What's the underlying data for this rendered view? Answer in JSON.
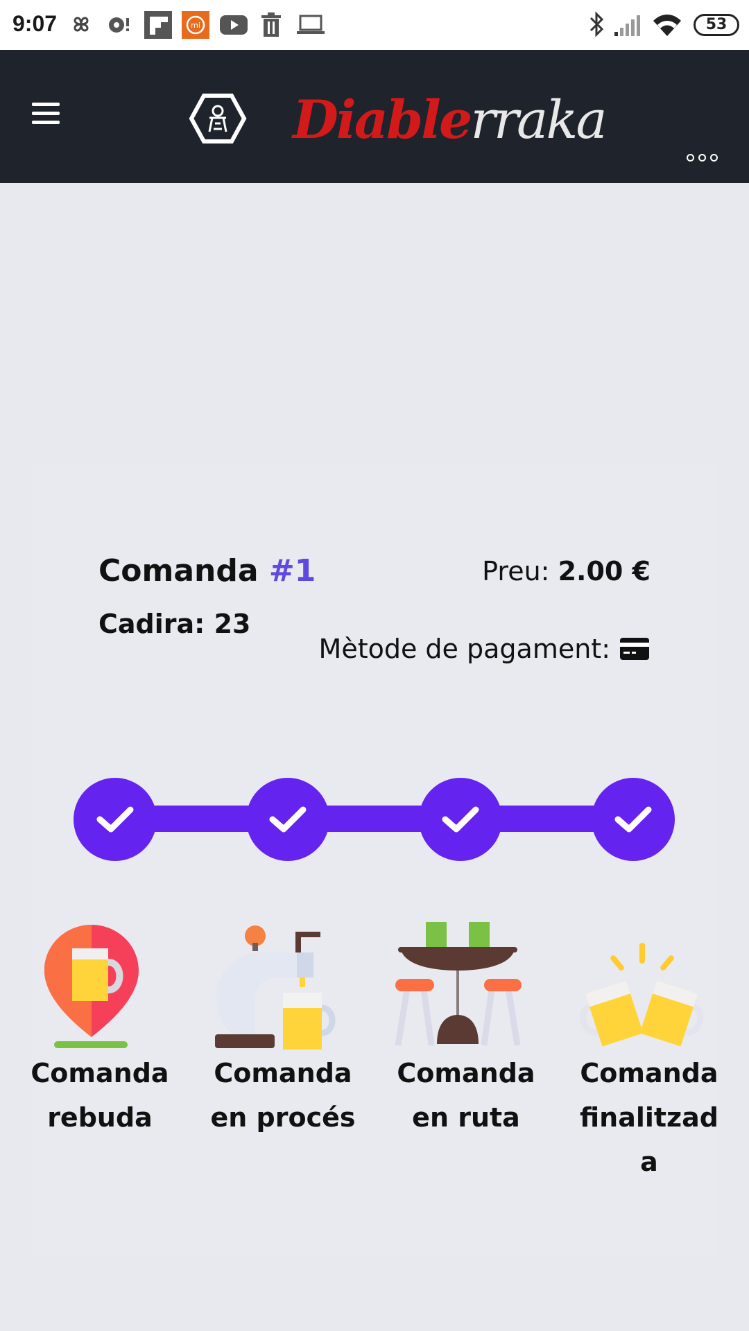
{
  "status_bar": {
    "time": "9:07",
    "battery": "53"
  },
  "header": {
    "brand_part1": "Diable",
    "brand_part2": "rraka"
  },
  "order": {
    "title_prefix": "Comanda",
    "number": "#1",
    "chair_label": "Cadira: 23",
    "price_label": "Preu:",
    "price_value": "2.00 €",
    "payment_label": "Mètode de pagament:",
    "payment_icon": "credit-card-icon"
  },
  "progress": {
    "completed_steps": 4,
    "total_steps": 4,
    "accent_color": "#6523f0",
    "steps": [
      {
        "label": "Comanda rebuda",
        "icon": "beer-location-pin-icon"
      },
      {
        "label": "Comanda en procés",
        "icon": "beer-tap-icon"
      },
      {
        "label": "Comanda en ruta",
        "icon": "bar-table-icon"
      },
      {
        "label": "Comanda finalitzada",
        "icon": "cheers-icon"
      }
    ]
  }
}
